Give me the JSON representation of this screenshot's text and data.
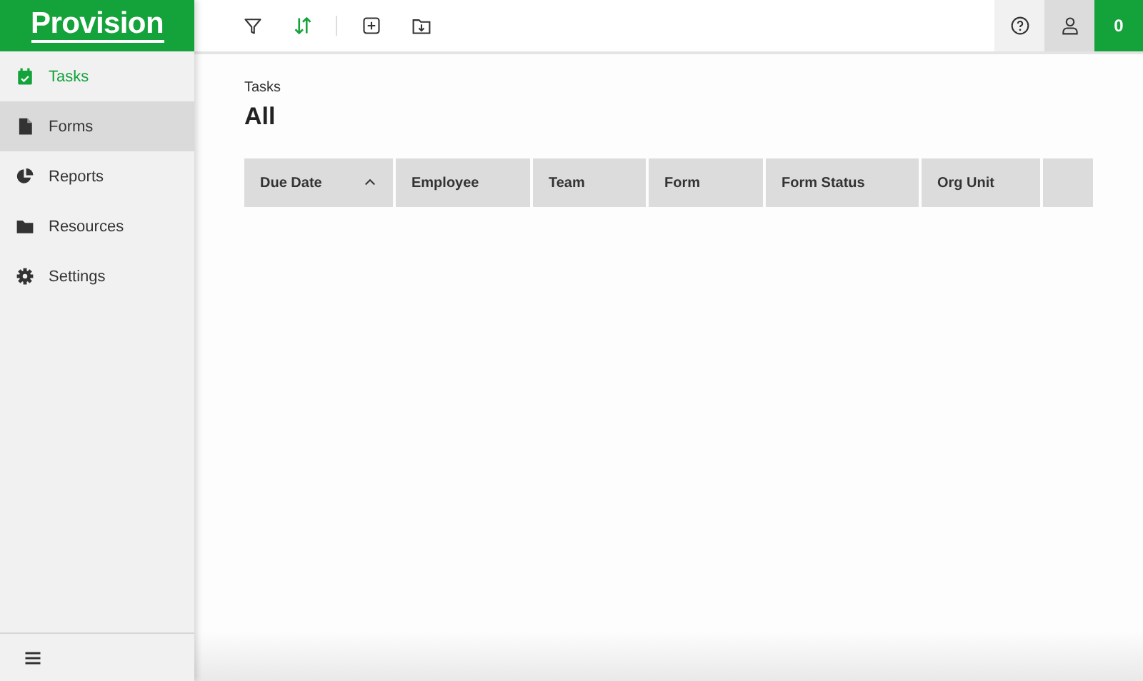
{
  "brand": {
    "name": "Provision"
  },
  "sidebar": {
    "items": [
      {
        "label": "Tasks",
        "selected": true,
        "hovered": false
      },
      {
        "label": "Forms",
        "selected": false,
        "hovered": true
      },
      {
        "label": "Reports",
        "selected": false,
        "hovered": false
      },
      {
        "label": "Resources",
        "selected": false,
        "hovered": false
      },
      {
        "label": "Settings",
        "selected": false,
        "hovered": false
      }
    ]
  },
  "toolbar": [
    {
      "active": false
    },
    {
      "active": true
    },
    {
      "active": false
    },
    {
      "active": false
    }
  ],
  "notifications": {
    "count": "0"
  },
  "page": {
    "breadcrumb": "Tasks",
    "title": "All"
  },
  "table": {
    "columns": [
      {
        "label": "Due Date",
        "sorted": true
      },
      {
        "label": "Employee",
        "sorted": false
      },
      {
        "label": "Team",
        "sorted": false
      },
      {
        "label": "Form",
        "sorted": false
      },
      {
        "label": "Form Status",
        "sorted": false
      },
      {
        "label": "Org Unit",
        "sorted": false
      }
    ]
  }
}
